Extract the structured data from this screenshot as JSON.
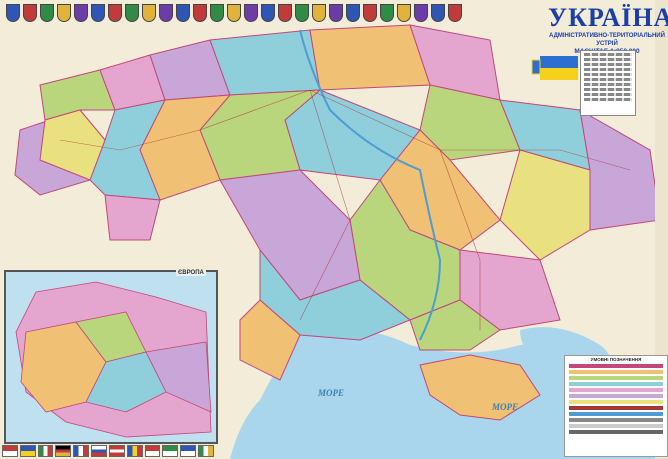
{
  "map": {
    "title": "УКРАЇНА",
    "subtitle": "АДМІНІСТРАТИВНО-ТЕРИТОРІАЛЬНИЙ УСТРІЙ",
    "scale": "МАСШТАБ 1:850 000",
    "inset_label": "ЄВРОПА",
    "legend_label": "УМОВНІ ПОЗНАЧЕННЯ",
    "sea_labels": [
      "МОРЕ",
      "МОРЕ"
    ],
    "colors": {
      "pink": "#e4a6cf",
      "green": "#b9d67c",
      "orange": "#f0c074",
      "blue": "#8fcfdc",
      "purple": "#c8a6d8",
      "yellow": "#e9e17f",
      "sea": "#a9d6ec",
      "background": "#f3ecd9",
      "border": "#c2477a",
      "crest": [
        "#2e57b5",
        "#c23b3b",
        "#2f8b45",
        "#e0b43a",
        "#6c3da8"
      ]
    }
  }
}
